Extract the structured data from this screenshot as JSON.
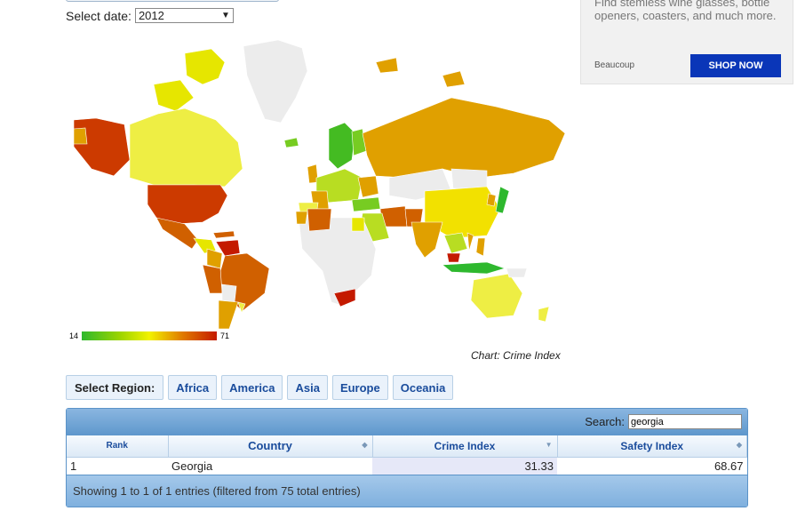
{
  "date_selector": {
    "label": "Select date:",
    "value": "2012"
  },
  "ad": {
    "text": "Find stemless wine glasses, bottle openers, coasters, and much more.",
    "brand": "Beaucoup",
    "button": "SHOP NOW"
  },
  "map": {
    "legend_min": "14",
    "legend_max": "71",
    "caption": "Chart: Crime Index",
    "colors": {
      "low": "#2eb82e",
      "mid": "#f2f200",
      "high": "#c41a00",
      "nodata": "#ececec"
    }
  },
  "regions": {
    "label": "Select Region:",
    "items": [
      "Africa",
      "America",
      "Asia",
      "Europe",
      "Oceania"
    ]
  },
  "table": {
    "search_label": "Search:",
    "search_value": "georgia",
    "columns": [
      "Rank",
      "Country",
      "Crime Index",
      "Safety Index"
    ],
    "rows": [
      {
        "rank": "1",
        "country": "Georgia",
        "crime": "31.33",
        "safety": "68.67"
      }
    ],
    "footer": "Showing 1 to 1 of 1 entries (filtered from 75 total entries)"
  }
}
